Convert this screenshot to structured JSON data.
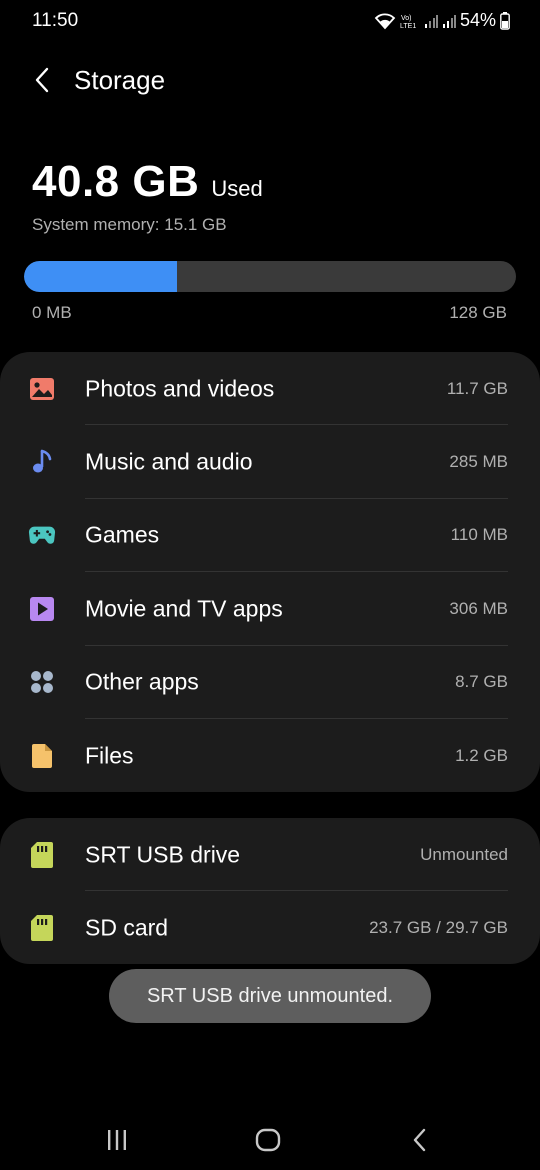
{
  "status_bar": {
    "time": "11:50",
    "battery": "54%",
    "network_label": "Vo) LTE1"
  },
  "header": {
    "title": "Storage"
  },
  "summary": {
    "used_value": "40.8 GB",
    "used_label": "Used",
    "system_memory": "System memory: 15.1 GB",
    "bar_min_label": "0 MB",
    "bar_max_label": "128 GB",
    "used_fraction": 0.31,
    "bar_color": "#3e8ff5"
  },
  "categories": [
    {
      "label": "Photos and videos",
      "value": "11.7 GB",
      "icon": "image-icon",
      "color": "#f07b6a"
    },
    {
      "label": "Music and audio",
      "value": "285 MB",
      "icon": "music-note-icon",
      "color": "#6b8cf0"
    },
    {
      "label": "Games",
      "value": "110 MB",
      "icon": "gamepad-icon",
      "color": "#4bc6c0"
    },
    {
      "label": "Movie and TV apps",
      "value": "306 MB",
      "icon": "play-icon",
      "color": "#b888f0"
    },
    {
      "label": "Other apps",
      "value": "8.7 GB",
      "icon": "apps-grid-icon",
      "color": "#a8b8cc"
    },
    {
      "label": "Files",
      "value": "1.2 GB",
      "icon": "file-icon",
      "color": "#f5c26b"
    }
  ],
  "devices": [
    {
      "label": "SRT USB drive",
      "value": "Unmounted",
      "icon": "sd-card-icon",
      "color": "#c5d65a"
    },
    {
      "label": "SD card",
      "value": "23.7 GB / 29.7 GB",
      "icon": "sd-card-icon",
      "color": "#c5d65a"
    }
  ],
  "toast": {
    "message": "SRT USB drive unmounted."
  },
  "nav": {
    "recents_icon": "recents-icon",
    "home_icon": "home-icon",
    "back_icon": "back-icon"
  }
}
